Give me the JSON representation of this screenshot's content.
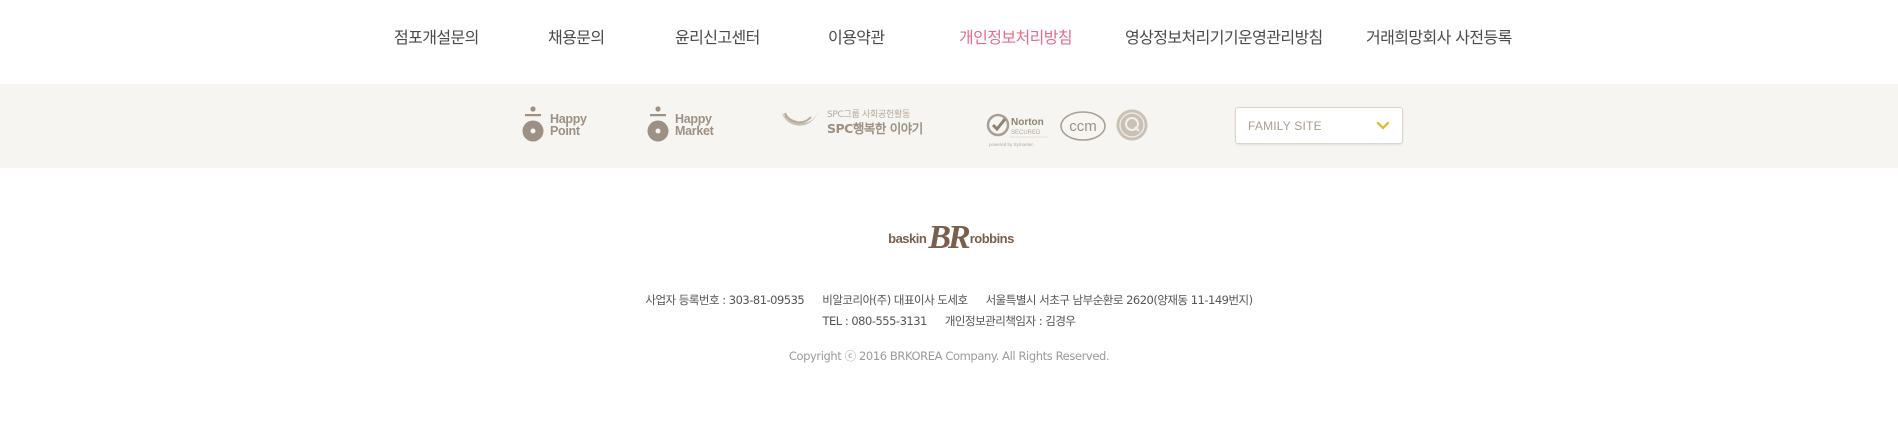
{
  "nav": {
    "items": [
      {
        "label": "점포개설문의"
      },
      {
        "label": "채용문의"
      },
      {
        "label": "윤리신고센터"
      },
      {
        "label": "이용약관"
      },
      {
        "label": "개인정보처리방침",
        "active": true
      },
      {
        "label": "영상정보처리기기운영관리방침"
      },
      {
        "label": "거래희망회사 사전등록"
      }
    ]
  },
  "partners": {
    "happy_point": {
      "line1": "Happy",
      "line2": "Point"
    },
    "happy_market": {
      "line1": "Happy",
      "line2": "Market"
    },
    "spc": {
      "small": "SPC그룹 사회공헌활동",
      "big": "SPC행복한 이야기"
    },
    "norton": {
      "title": "Norton",
      "sub": "SECURED",
      "powered": "powered by Symantec"
    },
    "ccm": {
      "label": "ccm"
    },
    "family_site": {
      "label": "FAMILY SITE"
    }
  },
  "footer": {
    "logo": {
      "left": "baskin",
      "mark": "BR",
      "right": "robbins"
    },
    "biz_no": "사업자 등록번호 : 303-81-09535",
    "company": "비알코리아(주) 대표이사 도세호",
    "address": "서울특별시 서초구 남부순환로 2620(양재동 11-149번지)",
    "tel": "TEL : 080-555-3131",
    "privacy_officer": "개인정보관리책임자 : 김경우",
    "copyright": "Copyright ⓒ 2016 BRKOREA Company. All Rights Reserved."
  },
  "colors": {
    "active_nav": "#e56d8c",
    "partner_bg": "#f7f5f2",
    "chevron": "#e8b93a",
    "logo_brown": "#7a5f4c"
  }
}
